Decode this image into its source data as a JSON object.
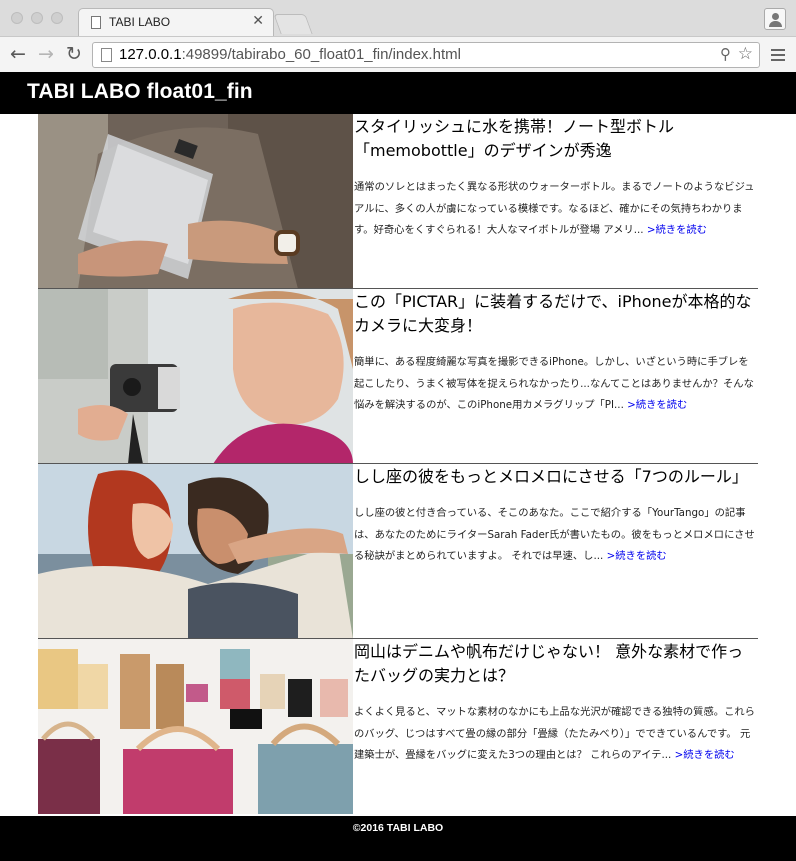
{
  "browser": {
    "tab_title": "TABI LABO",
    "url_host": "127.0.0.1",
    "url_path": ":49899/tabirabo_60_float01_fin/index.html",
    "icons": {
      "back": "arrow-left-icon",
      "forward": "arrow-right-icon",
      "reload": "reload-icon",
      "zoom": "zoom-icon",
      "bookmark": "star-icon",
      "menu": "hamburger-menu-icon",
      "profile": "profile-icon"
    }
  },
  "header": {
    "title": "TABI LABO float01_fin"
  },
  "articles": [
    {
      "title": "スタイリッシュに水を携帯！ノート型ボトル「memobottle」のデザインが秀逸",
      "excerpt": "通常のソレとはまったく異なる形状のウォーターボトル。まるでノートのようなビジュアルに、多くの人が虜になっている模様です。なるほど、確かにその気持ちわかります。好奇心をくすぐられる！大人なマイボトルが登場 アメリ...",
      "more": ">続きを読む",
      "image": "person-holding-memobottle"
    },
    {
      "title": "この「PICTAR」に装着するだけで、iPhoneが本格的なカメラに大変身！",
      "excerpt": "簡単に、ある程度綺麗な写真を撮影できるiPhone。しかし、いざという時に手ブレを起こしたり、うまく被写体を捉えられなかったり...なんてことはありませんか？そんな悩みを解決するのが、このiPhone用カメラグリップ「PI...",
      "more": ">続きを読む",
      "image": "woman-with-camera-grip"
    },
    {
      "title": "しし座の彼をもっとメロメロにさせる「7つのルール」",
      "excerpt": "しし座の彼と付き合っている、そこのあなた。ここで紹介する「YourTango」の記事は、あなたのためにライターSarah Fader氏が書いたもの。彼をもっとメロメロにさせる秘訣がまとめられていますよ。 それでは早速、し...",
      "more": ">続きを読む",
      "image": "couple-embracing"
    },
    {
      "title": "岡山はデニムや帆布だけじゃない！ 意外な素材で作ったバッグの実力とは？",
      "excerpt": "よくよく見ると、マットな素材のなかにも上品な光沢が確認できる独特の質感。これらのバッグ、じつはすべて畳の縁の部分「畳縁（たたみべり）」でできているんです。 元建築士が、畳縁をバッグに変えた3つの理由とは？ これらのアイテ...",
      "more": ">続きを読む",
      "image": "bags-flat-lay"
    }
  ],
  "footer": {
    "copyright": "©2016 TABI LABO"
  }
}
